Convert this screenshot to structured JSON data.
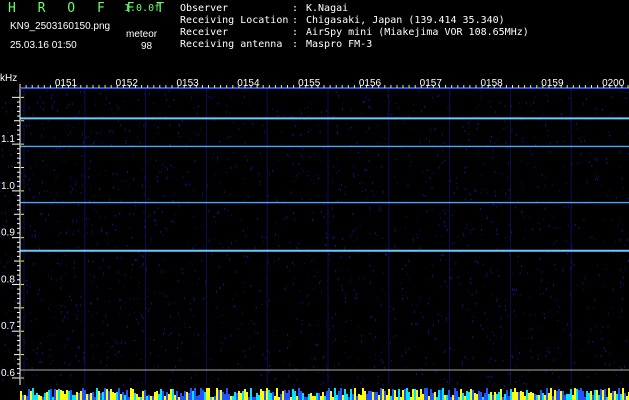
{
  "header": {
    "app_title": "H R O F F T",
    "version": "1.0.0f",
    "filename": "KN9_2503160150.png",
    "program": "meteor",
    "datetime": "25.03.16 01:50",
    "count": "98",
    "meta": [
      {
        "key": "Observer",
        "value": "K.Nagai"
      },
      {
        "key": "Receiving Location",
        "value": "Chigasaki, Japan (139.414 35.340)"
      },
      {
        "key": "Receiver",
        "value": "AirSpy mini (Miakejima VOR 108.65MHz)"
      },
      {
        "key": "Receiving antenna",
        "value": "Maspro FM-3"
      }
    ]
  },
  "chart_data": {
    "type": "heatmap",
    "ylabel": "kHz",
    "y_tick_labels": [
      "1.1",
      "1.0",
      "0.9",
      "0.8",
      "0.7",
      "0.6"
    ],
    "y_ticks": [
      1.1,
      1.0,
      0.9,
      0.8,
      0.7,
      0.6
    ],
    "ylim": [
      0.585,
      1.22
    ],
    "time_labels": [
      "0151",
      "0152",
      "0153",
      "0154",
      "0155",
      "0156",
      "0157",
      "0158",
      "0159",
      "0200"
    ],
    "horizontal_lines_khz": [
      1.155,
      1.095,
      0.975,
      0.872
    ],
    "colors": {
      "background": "#000000",
      "signal": "#4aa8ff",
      "strong_signal": "#66ccff",
      "noise": "#10168a",
      "axis": "#ffffff",
      "marker": "#ffff00",
      "label_bg": "#ffff00"
    }
  }
}
